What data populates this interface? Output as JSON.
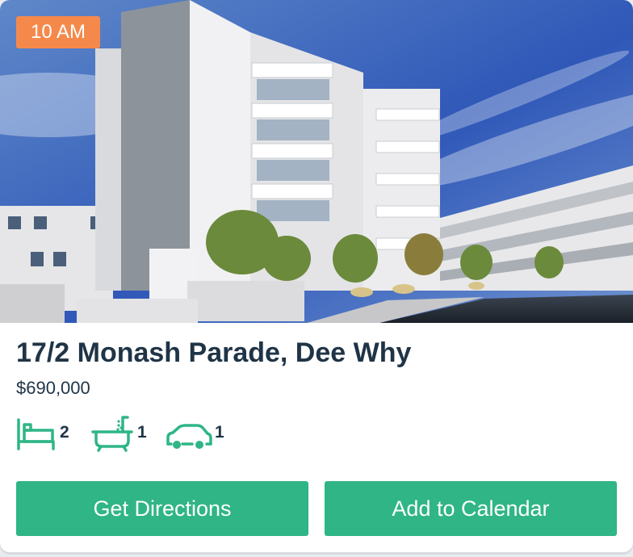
{
  "listing": {
    "time_badge": "10 AM",
    "address": "17/2 Monash Parade, Dee Why",
    "price": "$690,000",
    "features": [
      {
        "icon": "bed-icon",
        "count": "2"
      },
      {
        "icon": "bathtub-icon",
        "count": "1"
      },
      {
        "icon": "car-icon",
        "count": "1"
      }
    ]
  },
  "actions": {
    "directions_label": "Get Directions",
    "calendar_label": "Add to Calendar"
  },
  "colors": {
    "accent": "#2fb586",
    "badge": "#f5894c",
    "text": "#1f3446"
  }
}
